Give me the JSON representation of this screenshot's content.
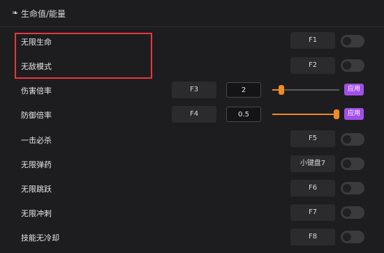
{
  "header": {
    "icon": "feather-icon",
    "title": "生命值/能量"
  },
  "rows": [
    {
      "label": "无限生命",
      "hotkey": "F1",
      "toggle_on": false
    },
    {
      "label": "无敌模式",
      "hotkey": "F2",
      "toggle_on": false
    },
    {
      "label": "伤害倍率",
      "hotkey": "F3",
      "value": "2",
      "slider_fraction": 0.1,
      "apply_label": "应用"
    },
    {
      "label": "防御倍率",
      "hotkey": "F4",
      "value": "0.5",
      "slider_fraction": 1.0,
      "apply_label": "应用"
    },
    {
      "label": "一击必杀",
      "hotkey": "F5",
      "toggle_on": false
    },
    {
      "label": "无限弹药",
      "hotkey": "小键盘7",
      "toggle_on": false
    },
    {
      "label": "无限跳跃",
      "hotkey": "F6",
      "toggle_on": false
    },
    {
      "label": "无限冲刺",
      "hotkey": "F7",
      "toggle_on": false
    },
    {
      "label": "技能无冷却",
      "hotkey": "F8",
      "toggle_on": false
    }
  ],
  "colors": {
    "accent_orange": "#f08a24",
    "apply_purple": "#a14fe6",
    "highlight_red": "#e8373d"
  }
}
